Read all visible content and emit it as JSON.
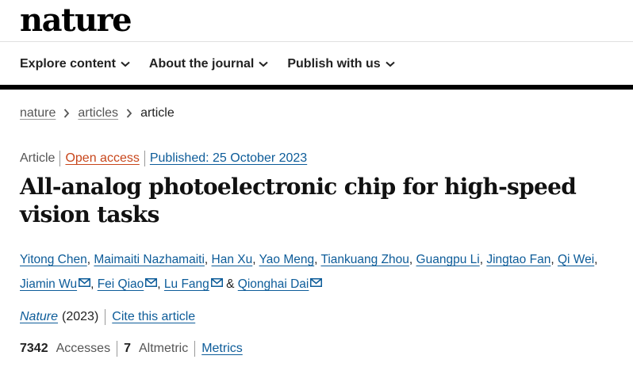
{
  "header": {
    "logo": "nature",
    "nav": [
      {
        "label": "Explore content"
      },
      {
        "label": "About the journal"
      },
      {
        "label": "Publish with us"
      }
    ]
  },
  "breadcrumb": [
    "nature",
    "articles",
    "article"
  ],
  "article_meta": {
    "type": "Article",
    "access": "Open access",
    "published": "Published: 25 October 2023"
  },
  "title": "All-analog photoelectronic chip for high-speed vision tasks",
  "authors": [
    {
      "name": "Yitong Chen",
      "email": false
    },
    {
      "name": "Maimaiti Nazhamaiti",
      "email": false
    },
    {
      "name": "Han Xu",
      "email": false
    },
    {
      "name": "Yao Meng",
      "email": false
    },
    {
      "name": "Tiankuang Zhou",
      "email": false
    },
    {
      "name": "Guangpu Li",
      "email": false
    },
    {
      "name": "Jingtao Fan",
      "email": false
    },
    {
      "name": "Qi Wei",
      "email": false
    },
    {
      "name": "Jiamin Wu",
      "email": true
    },
    {
      "name": "Fei Qiao",
      "email": true
    },
    {
      "name": "Lu Fang",
      "email": true
    },
    {
      "name": "Qionghai Dai",
      "email": true
    }
  ],
  "citation": {
    "journal": "Nature",
    "year": "(2023)",
    "cite_label": "Cite this article"
  },
  "metrics": {
    "accesses_count": "7342",
    "accesses_label": "Accesses",
    "altmetric_count": "7",
    "altmetric_label": "Altmetric",
    "metrics_link": "Metrics"
  },
  "colors": {
    "link": "#0d5c99",
    "open_access": "#c8461b"
  }
}
